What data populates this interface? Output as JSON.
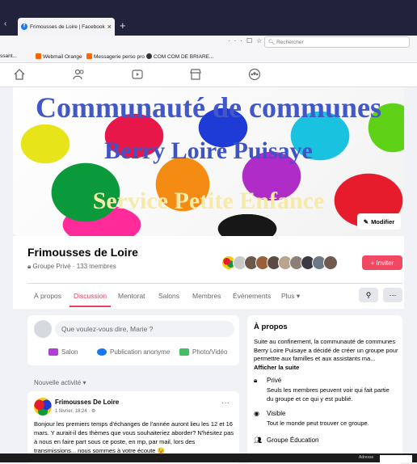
{
  "browser": {
    "tab_title": "Frimousses de Loire | Facebook",
    "search_placeholder": "Rechercher",
    "bookmarks": [
      "ssant...",
      "Webmail Orange",
      "Messagerie perso pro",
      "COM COM DE BRIARE..."
    ]
  },
  "cover": {
    "line1": "Communauté de communes",
    "line2": "Berry Loire Puisaye",
    "line3": "Service Petite Enfance",
    "edit_label": "Modifier"
  },
  "group": {
    "name": "Frimousses de Loire",
    "meta": "Groupe Privé · 133 membres",
    "invite_label": "+ Inviter"
  },
  "tabs": [
    "À propos",
    "Discussion",
    "Mentorat",
    "Salons",
    "Membres",
    "Événements",
    "Plus ▾"
  ],
  "active_tab": "Discussion",
  "composer": {
    "placeholder": "Que voulez-vous dire, Marie ?",
    "actions": [
      "Salon",
      "Publication anonyme",
      "Photo/Vidéo"
    ]
  },
  "feed": {
    "sort_label": "Nouvelle activité ▾",
    "post": {
      "author": "Frimousses De Loire",
      "date": "1 février, 18:24 · ⚙",
      "body": "Bonjour les premiers temps d'échanges de l'année auront lieu les 12 et 16 mars. Y aurait-il des thèmes que vous souhaiteriez aborder? N'hésitez pas à nous en faire part sous ce poste, en mp, par mail, lors des transmissions... nous sommes à votre écoute 😉"
    }
  },
  "about": {
    "title": "À propos",
    "description": "Suite au confinement, la communauté de communes Berry Loire Puisaye a décidé de créer un groupe pour permettre aux familles et aux assistants ma...",
    "see_more": "Afficher la suite",
    "items": [
      {
        "icon": "lock-icon",
        "title": "Privé",
        "detail": "Seuls les membres peuvent voir qui fait partie du groupe et ce qui y est publié."
      },
      {
        "icon": "eye-icon",
        "title": "Visible",
        "detail": "Tout le monde peut trouver ce groupe."
      },
      {
        "icon": "group-icon",
        "title": "Groupe Éducation",
        "detail": ""
      }
    ]
  },
  "taskbar": {
    "text": "Adresse"
  },
  "colors": {
    "accent": "#e8415f",
    "invite": "#f24863",
    "facebook": "#1877f2"
  }
}
